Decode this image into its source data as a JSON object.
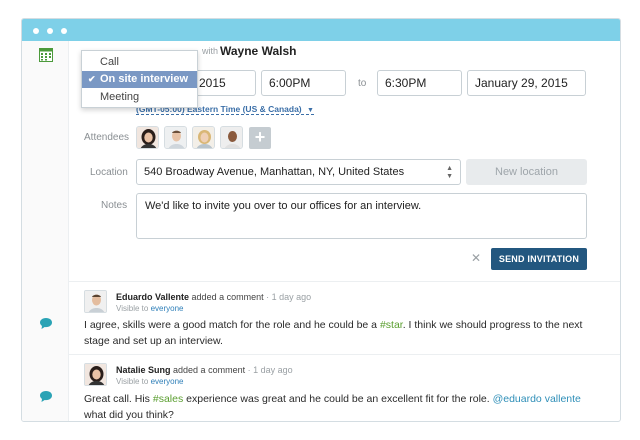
{
  "meeting_form": {
    "with_label": "with",
    "with_name": "Wayne Walsh",
    "meeting_types": [
      "Call",
      "On site interview",
      "Meeting"
    ],
    "selected_type_index": 1,
    "start_date_visible": "2015",
    "start_time": "6:00PM",
    "to_label": "to",
    "end_time": "6:30PM",
    "end_date": "January 29, 2015",
    "timezone": "(GMT-05:00) Eastern Time (US & Canada)",
    "attendees_label": "Attendees",
    "attendees": [
      "attendee-1",
      "attendee-2",
      "attendee-3",
      "attendee-4"
    ],
    "add_attendee_symbol": "+",
    "location_label": "Location",
    "location_value": "540 Broadway Avenue, Manhattan, NY, United States",
    "new_location_label": "New location",
    "notes_label": "Notes",
    "notes_value": "We'd like to invite you over to our offices for an interview.",
    "cancel_symbol": "✕",
    "send_label": "SEND INVITATION"
  },
  "comments": [
    {
      "author": "Eduardo Vallente",
      "action": "added a comment",
      "time": "1 day ago",
      "visibility_prefix": "Visible to",
      "visibility_target": "everyone",
      "body_part1": "I agree, skills were a good match for the role and he could be a ",
      "tag": "#star",
      "body_part2": ". I think we should progress to the next stage and set up an interview."
    },
    {
      "author": "Natalie Sung",
      "action": "added a comment",
      "time": "1 day ago",
      "visibility_prefix": "Visible to",
      "visibility_target": "everyone",
      "body_part1": "Great call. His ",
      "tag": "#sales",
      "body_part2": " experience was great and he could be an excellent fit for the role. ",
      "mention": "@eduardo vallente",
      "body_part3": " what did you think?"
    }
  ],
  "colors": {
    "titlebar": "#7ed0e8",
    "primary_button": "#23577f",
    "dropdown_selected": "#7a98c4",
    "tag": "#5a9e2f",
    "mention": "#2f8fb8",
    "calendar_icon": "#4c9a3b",
    "comment_icon": "#2aa3b5"
  },
  "icons": {
    "calendar": "calendar-icon",
    "comment": "comment-bubble-icon",
    "check": "check-icon",
    "select_arrows": "updown-arrows-icon",
    "timezone_caret": "caret-down-icon",
    "close": "close-icon"
  }
}
